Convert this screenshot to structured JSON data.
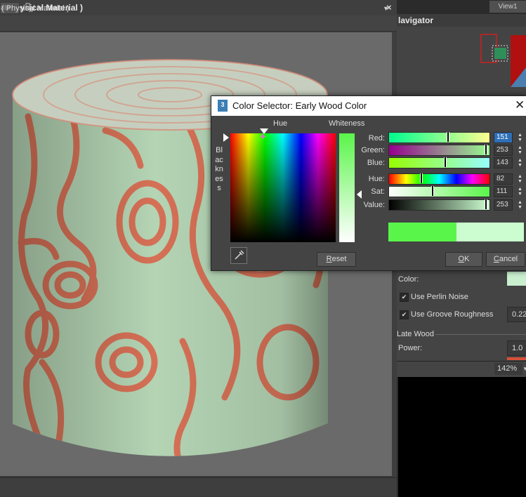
{
  "left_window": {
    "title": "( Physical Material )",
    "close": "×",
    "update_label": "date",
    "bottom_material": "( Physical Material )"
  },
  "right_panel": {
    "view_tab": "View1",
    "navigator_title": "lavigator",
    "color_label": "Color:",
    "use_perlin_noise": "Use Perlin Noise",
    "use_groove_roughness": "Use Groove Roughness",
    "groove_value": "0.22",
    "late_wood_label": "Late Wood",
    "power_label": "Power:",
    "power_value": "1.0",
    "zoom": "142%",
    "color_swatch_hex": "#c9efcf"
  },
  "dialog": {
    "icon_text": "3",
    "title": "Color Selector: Early Wood Color",
    "close": "✕",
    "hue_label": "Hue",
    "whiteness_label": "Whiteness",
    "blackness_label": "Blackness",
    "reset_label": "Reset",
    "ok_label": "OK",
    "cancel_label": "Cancel",
    "sliders": {
      "red": {
        "label": "Red:",
        "value": "151"
      },
      "green": {
        "label": "Green:",
        "value": "253"
      },
      "blue": {
        "label": "Blue:",
        "value": "143"
      },
      "hue": {
        "label": "Hue:",
        "value": "82"
      },
      "sat": {
        "label": "Sat:",
        "value": "111"
      },
      "value": {
        "label": "Value:",
        "value": "253"
      }
    },
    "new_color_hex": "#5af54a",
    "old_color_hex": "#ccfdd0"
  }
}
